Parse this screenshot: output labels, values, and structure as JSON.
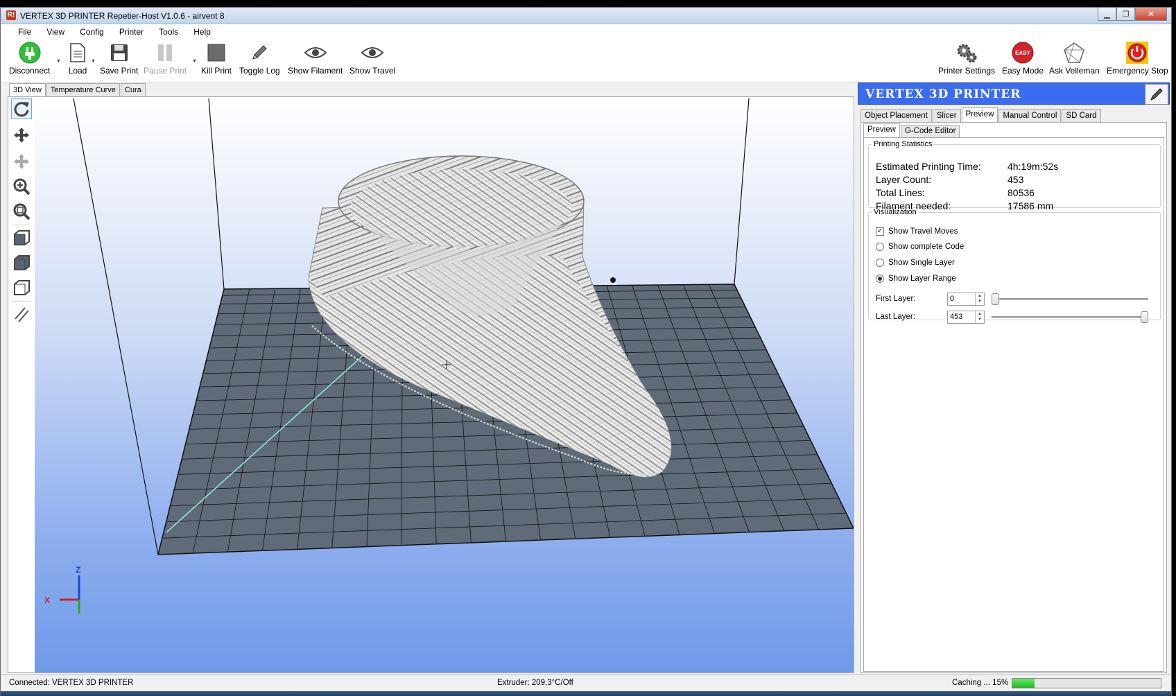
{
  "window": {
    "title": "VERTEX 3D PRINTER Repetier-Host V1.0.6 - airvent 8",
    "app_icon": "R!",
    "controls": [
      "minimize",
      "maximize",
      "close"
    ]
  },
  "menu": [
    "File",
    "View",
    "Config",
    "Printer",
    "Tools",
    "Help"
  ],
  "toolbar": {
    "disconnect": "Disconnect",
    "load": "Load",
    "save_print": "Save Print",
    "pause_print": "Pause Print",
    "kill_print": "Kill Print",
    "toggle_log": "Toggle Log",
    "show_filament": "Show Filament",
    "show_travel": "Show Travel",
    "printer_settings": "Printer Settings",
    "easy_mode": "Easy Mode",
    "easy_badge": "EASY",
    "ask_velleman": "Ask Velleman",
    "emergency_stop": "Emergency Stop"
  },
  "view_tabs": [
    "3D View",
    "Temperature Curve",
    "Cura"
  ],
  "axes": {
    "x": "X",
    "z": "Z"
  },
  "panel": {
    "brand": "VERTEX 3D PRINTER",
    "tabs": [
      "Object Placement",
      "Slicer",
      "Preview",
      "Manual Control",
      "SD Card"
    ],
    "subtabs": [
      "Preview",
      "G-Code Editor"
    ],
    "stats_title": "Printing Statistics",
    "stats": [
      {
        "label": "Estimated Printing Time:",
        "value": "4h:19m:52s"
      },
      {
        "label": "Layer Count:",
        "value": "453"
      },
      {
        "label": "Total Lines:",
        "value": "80536"
      },
      {
        "label": "Filament needed:",
        "value": "17586 mm"
      }
    ],
    "vis_title": "Visualization",
    "options": {
      "travel": "Show Travel Moves",
      "complete": "Show complete Code",
      "single": "Show Single Layer",
      "range": "Show Layer Range"
    },
    "first_layer_label": "First Layer:",
    "first_layer_value": "0",
    "last_layer_label": "Last Layer:",
    "last_layer_value": "453",
    "first_layer_fraction": 0,
    "last_layer_fraction": 1
  },
  "status": {
    "connection": "Connected: VERTEX 3D PRINTER",
    "extruder": "Extruder: 209,3°C/Off",
    "caching": "Caching ... 15%",
    "progress_percent": 15
  },
  "colors": {
    "brand_blue": "#3b6cf0",
    "bed": "#5f6b78",
    "model": "#e6e6e6",
    "progress": "#22bb22"
  }
}
